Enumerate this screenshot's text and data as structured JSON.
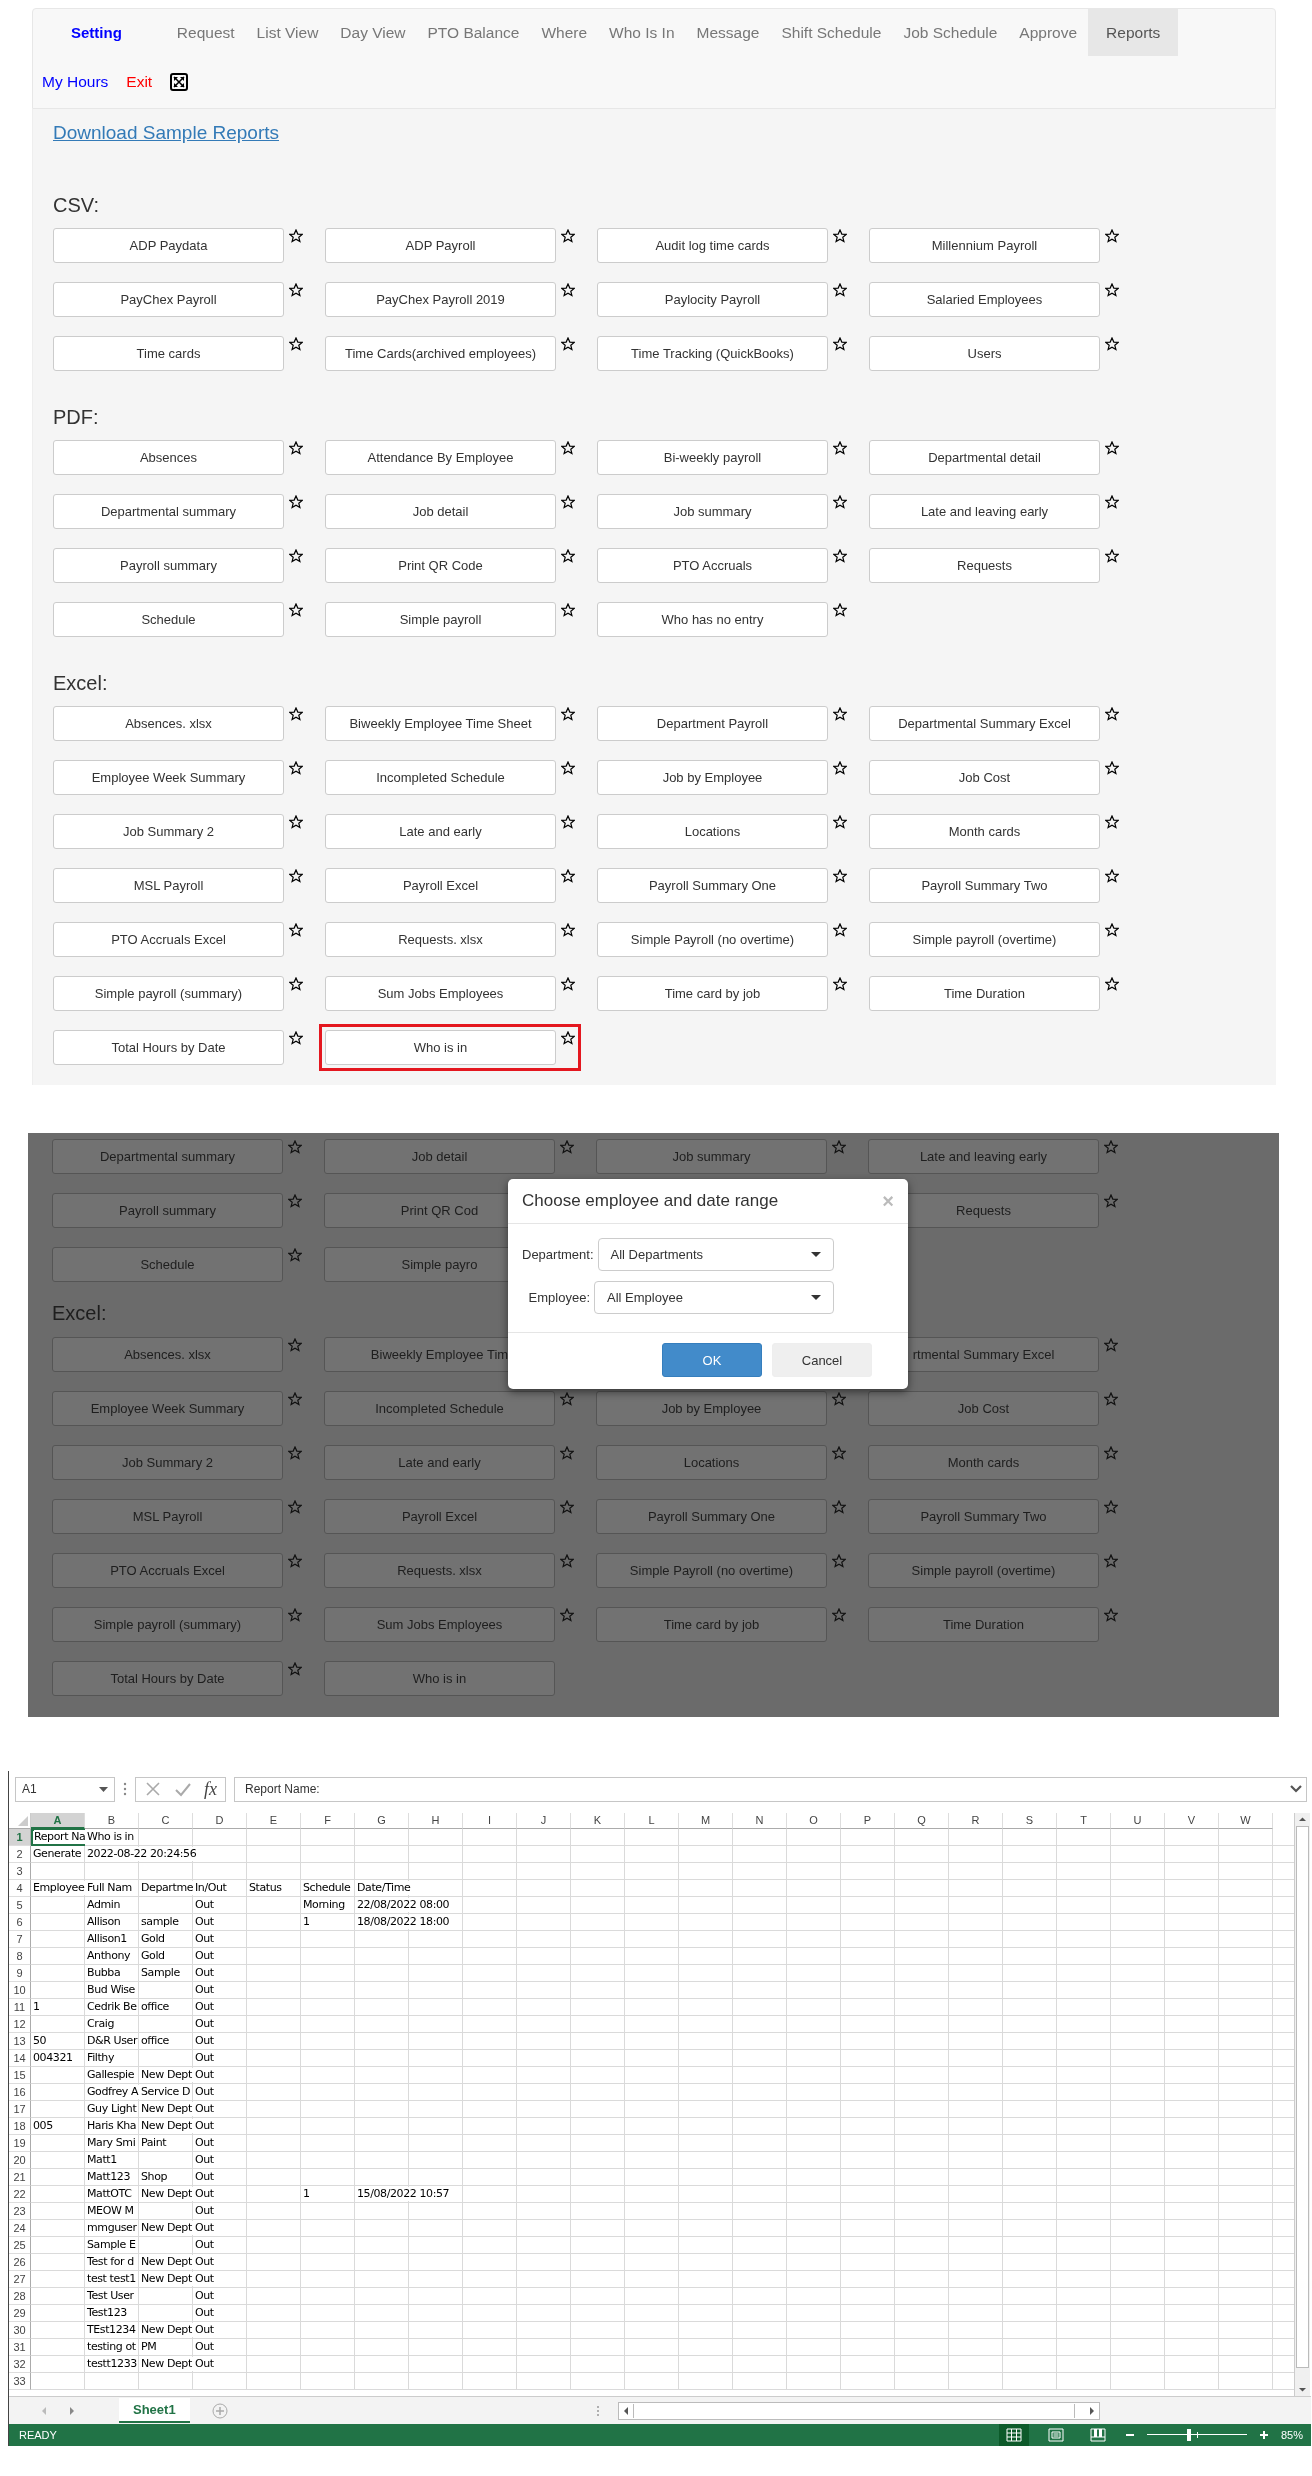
{
  "nav": {
    "brand": "Setting",
    "tabs": [
      {
        "label": "Request",
        "selected": false
      },
      {
        "label": "List View",
        "selected": false
      },
      {
        "label": "Day View",
        "selected": false
      },
      {
        "label": "PTO Balance",
        "selected": false
      },
      {
        "label": "Where",
        "selected": false
      },
      {
        "label": "Who Is In",
        "selected": false
      },
      {
        "label": "Message",
        "selected": false
      },
      {
        "label": "Shift Schedule",
        "selected": false
      },
      {
        "label": "Job Schedule",
        "selected": false
      },
      {
        "label": "Approve",
        "selected": false
      },
      {
        "label": "Reports",
        "selected": true
      }
    ],
    "links": [
      {
        "label": "My Hours",
        "color": "#0000ff"
      },
      {
        "label": "Exit",
        "color": "#ff0000"
      }
    ]
  },
  "reports": {
    "download_link": "Download Sample Reports",
    "sections": [
      {
        "title": "CSV:",
        "items": [
          {
            "label": "ADP Paydata"
          },
          {
            "label": "ADP Payroll"
          },
          {
            "label": "Audit log time cards"
          },
          {
            "label": "Millennium Payroll"
          },
          {
            "label": "PayChex Payroll"
          },
          {
            "label": "PayChex Payroll 2019"
          },
          {
            "label": "Paylocity Payroll"
          },
          {
            "label": "Salaried Employees"
          },
          {
            "label": "Time cards"
          },
          {
            "label": "Time Cards(archived employees)"
          },
          {
            "label": "Time Tracking (QuickBooks)"
          },
          {
            "label": "Users"
          }
        ]
      },
      {
        "title": "PDF:",
        "items": [
          {
            "label": "Absences"
          },
          {
            "label": "Attendance By Employee"
          },
          {
            "label": "Bi-weekly payroll"
          },
          {
            "label": "Departmental detail"
          },
          {
            "label": "Departmental summary"
          },
          {
            "label": "Job detail"
          },
          {
            "label": "Job summary"
          },
          {
            "label": "Late and leaving early"
          },
          {
            "label": "Payroll summary"
          },
          {
            "label": "Print QR Code"
          },
          {
            "label": "PTO Accruals"
          },
          {
            "label": "Requests"
          },
          {
            "label": "Schedule"
          },
          {
            "label": "Simple payroll"
          },
          {
            "label": "Who has no entry"
          }
        ]
      },
      {
        "title": "Excel:",
        "items": [
          {
            "label": "Absences. xlsx",
            "highlighted": false
          },
          {
            "label": "Biweekly Employee Time Sheet",
            "highlighted": false
          },
          {
            "label": "Department Payroll",
            "highlighted": false
          },
          {
            "label": "Departmental Summary Excel",
            "highlighted": false
          },
          {
            "label": "Employee Week Summary",
            "highlighted": false
          },
          {
            "label": "Incompleted Schedule",
            "highlighted": false
          },
          {
            "label": "Job by Employee",
            "highlighted": false
          },
          {
            "label": "Job Cost",
            "highlighted": false
          },
          {
            "label": "Job Summary 2",
            "highlighted": false
          },
          {
            "label": "Late and early",
            "highlighted": false
          },
          {
            "label": "Locations",
            "highlighted": false
          },
          {
            "label": "Month cards",
            "highlighted": false
          },
          {
            "label": "MSL Payroll",
            "highlighted": false
          },
          {
            "label": "Payroll Excel",
            "highlighted": false
          },
          {
            "label": "Payroll Summary One",
            "highlighted": false
          },
          {
            "label": "Payroll Summary Two",
            "highlighted": false
          },
          {
            "label": "PTO Accruals Excel",
            "highlighted": false
          },
          {
            "label": "Requests. xlsx",
            "highlighted": false
          },
          {
            "label": "Simple Payroll (no overtime)",
            "highlighted": false
          },
          {
            "label": "Simple payroll (overtime)",
            "highlighted": false
          },
          {
            "label": "Simple payroll (summary)",
            "highlighted": false
          },
          {
            "label": "Sum Jobs Employees",
            "highlighted": false
          },
          {
            "label": "Time card by job",
            "highlighted": false
          },
          {
            "label": "Time Duration",
            "highlighted": false
          },
          {
            "label": "Total Hours by Date",
            "highlighted": false
          },
          {
            "label": "Who is in",
            "highlighted": true
          }
        ]
      }
    ]
  },
  "dialog_view": {
    "pdf_rows": [
      {
        "left": [
          "Departmental summary",
          "Job detail"
        ],
        "right": [
          "Job summary",
          "Late and leaving early"
        ]
      },
      {
        "left": [
          "Payroll summary",
          "Print QR Cod"
        ],
        "right": [
          "Requests"
        ]
      },
      {
        "left": [
          "Schedule",
          "Simple payro"
        ]
      }
    ],
    "section_title": "Excel:",
    "excel_rows": [
      {
        "left": [
          "Absences. xlsx",
          "Biweekly Employee Tim"
        ],
        "right": [
          "rtmental Summary Excel"
        ]
      },
      {
        "left": [
          "Employee Week Summary",
          "Incompleted Schedule"
        ],
        "right": [
          "Job by Employee",
          "Job Cost"
        ]
      },
      {
        "left": [
          "Job Summary 2",
          "Late and early"
        ],
        "right": [
          "Locations",
          "Month cards"
        ]
      },
      {
        "left": [
          "MSL Payroll",
          "Payroll Excel"
        ],
        "right": [
          "Payroll Summary One",
          "Payroll Summary Two"
        ]
      },
      {
        "left": [
          "PTO Accruals Excel",
          "Requests. xlsx"
        ],
        "right": [
          "Simple Payroll (no overtime)",
          "Simple payroll (overtime)"
        ]
      },
      {
        "left": [
          "Simple payroll (summary)",
          "Sum Jobs Employees"
        ],
        "right": [
          "Time card by job",
          "Time Duration"
        ]
      },
      {
        "left": [
          "Total Hours by Date",
          "Who is in"
        ]
      }
    ],
    "modal": {
      "title": "Choose employee and date range",
      "close": "×",
      "fields": [
        {
          "label": "Department:",
          "value": "All Departments"
        },
        {
          "label": "Employee:",
          "value": "All Employee"
        }
      ],
      "buttons": [
        {
          "label": "OK",
          "kind": "primary"
        },
        {
          "label": "Cancel",
          "kind": "default"
        }
      ]
    }
  },
  "spreadsheet": {
    "name_box": "A1",
    "function_label": "fx",
    "formula": "Report Name:",
    "columns": [
      {
        "label": "A",
        "selected": true
      },
      {
        "label": "B",
        "selected": false
      },
      {
        "label": "C",
        "selected": false
      },
      {
        "label": "D",
        "selected": false
      },
      {
        "label": "E",
        "selected": false
      },
      {
        "label": "F",
        "selected": false
      },
      {
        "label": "G",
        "selected": false
      },
      {
        "label": "H",
        "selected": false
      },
      {
        "label": "I",
        "selected": false
      },
      {
        "label": "J",
        "selected": false
      },
      {
        "label": "K",
        "selected": false
      },
      {
        "label": "L",
        "selected": false
      },
      {
        "label": "M",
        "selected": false
      },
      {
        "label": "N",
        "selected": false
      },
      {
        "label": "O",
        "selected": false
      },
      {
        "label": "P",
        "selected": false
      },
      {
        "label": "Q",
        "selected": false
      },
      {
        "label": "R",
        "selected": false
      },
      {
        "label": "S",
        "selected": false
      },
      {
        "label": "T",
        "selected": false
      },
      {
        "label": "U",
        "selected": false
      },
      {
        "label": "V",
        "selected": false
      },
      {
        "label": "W",
        "selected": false
      }
    ],
    "rows": [
      {
        "number": "1",
        "selected": true,
        "cells": {
          "A": "Report Na",
          "B": "Who is in"
        }
      },
      {
        "number": "2",
        "selected": false,
        "cells": {
          "A": "Generate",
          "B": "2022-08-22 20:24:56"
        }
      },
      {
        "number": "3",
        "selected": false
      },
      {
        "number": "4",
        "selected": false,
        "cells": {
          "A": "Employee",
          "B": "Full Nam",
          "C": "Departme",
          "D": "In/Out",
          "E": "Status",
          "F": "Schedule",
          "G": "Date/Time"
        }
      },
      {
        "number": "5",
        "selected": false,
        "cells": {
          "B": "Admin",
          "D": "Out",
          "F": "Morning",
          "G": "22/08/2022 08:00"
        }
      },
      {
        "number": "6",
        "selected": false,
        "cells": {
          "B": "Allison",
          "C": "sample",
          "D": "Out",
          "F": "1",
          "G": "18/08/2022 18:00"
        }
      },
      {
        "number": "7",
        "selected": false,
        "cells": {
          "B": "Allison1",
          "C": "Gold",
          "D": "Out"
        }
      },
      {
        "number": "8",
        "selected": false,
        "cells": {
          "B": "Anthony",
          "C": "Gold",
          "D": "Out"
        }
      },
      {
        "number": "9",
        "selected": false,
        "cells": {
          "B": "Bubba",
          "C": "Sample",
          "D": "Out"
        }
      },
      {
        "number": "10",
        "selected": false,
        "cells": {
          "B": "Bud Wise",
          "D": "Out"
        }
      },
      {
        "number": "11",
        "selected": false,
        "cells": {
          "A": "1",
          "B": "Cedrik Be",
          "C": "office",
          "D": "Out"
        }
      },
      {
        "number": "12",
        "selected": false,
        "cells": {
          "B": "Craig",
          "D": "Out"
        }
      },
      {
        "number": "13",
        "selected": false,
        "cells": {
          "A": "50",
          "B": "D&R User",
          "C": "office",
          "D": "Out"
        }
      },
      {
        "number": "14",
        "selected": false,
        "cells": {
          "A": "004321",
          "B": "Filthy",
          "D": "Out"
        }
      },
      {
        "number": "15",
        "selected": false,
        "cells": {
          "B": "Gallespie",
          "C": "New Dept",
          "D": "Out"
        }
      },
      {
        "number": "16",
        "selected": false,
        "cells": {
          "B": "Godfrey A",
          "C": "Service D",
          "D": "Out"
        }
      },
      {
        "number": "17",
        "selected": false,
        "cells": {
          "B": "Guy Light",
          "C": "New Dept",
          "D": "Out"
        }
      },
      {
        "number": "18",
        "selected": false,
        "cells": {
          "A": "005",
          "B": "Haris Kha",
          "C": "New Dept",
          "D": "Out"
        }
      },
      {
        "number": "19",
        "selected": false,
        "cells": {
          "B": "Mary Smi",
          "C": "Paint",
          "D": "Out"
        }
      },
      {
        "number": "20",
        "selected": false,
        "cells": {
          "B": "Matt1",
          "D": "Out"
        }
      },
      {
        "number": "21",
        "selected": false,
        "cells": {
          "B": "Matt123",
          "C": "Shop",
          "D": "Out"
        }
      },
      {
        "number": "22",
        "selected": false,
        "cells": {
          "B": "MattOTC",
          "C": "New Dept",
          "D": "Out",
          "F": "1",
          "G": "15/08/2022 10:57"
        }
      },
      {
        "number": "23",
        "selected": false,
        "cells": {
          "B": "MEOW M",
          "D": "Out"
        }
      },
      {
        "number": "24",
        "selected": false,
        "cells": {
          "B": "mmguser",
          "C": "New Dept",
          "D": "Out"
        }
      },
      {
        "number": "25",
        "selected": false,
        "cells": {
          "B": "Sample E",
          "D": "Out"
        }
      },
      {
        "number": "26",
        "selected": false,
        "cells": {
          "B": "Test for d",
          "C": "New Dept",
          "D": "Out"
        }
      },
      {
        "number": "27",
        "selected": false,
        "cells": {
          "B": "test test1",
          "C": "New Dept",
          "D": "Out"
        }
      },
      {
        "number": "28",
        "selected": false,
        "cells": {
          "B": "Test User",
          "D": "Out"
        }
      },
      {
        "number": "29",
        "selected": false,
        "cells": {
          "B": "Test123",
          "D": "Out"
        }
      },
      {
        "number": "30",
        "selected": false,
        "cells": {
          "B": "TEst1234",
          "C": "New Dept",
          "D": "Out"
        }
      },
      {
        "number": "31",
        "selected": false,
        "cells": {
          "B": "testing ot",
          "C": "PM",
          "D": "Out"
        }
      },
      {
        "number": "32",
        "selected": false,
        "cells": {
          "B": "testt1233",
          "C": "New Dept",
          "D": "Out"
        }
      },
      {
        "number": "33",
        "selected": false
      }
    ],
    "sheet_tabs": [
      {
        "label": "Sheet1",
        "selected": true
      }
    ],
    "status": "READY",
    "views": [
      {
        "kind": "normal",
        "selected": true
      },
      {
        "kind": "page_layout",
        "selected": false
      },
      {
        "kind": "page_break",
        "selected": false
      }
    ],
    "zoom": {
      "level": 0.42,
      "reading": "85%"
    }
  }
}
